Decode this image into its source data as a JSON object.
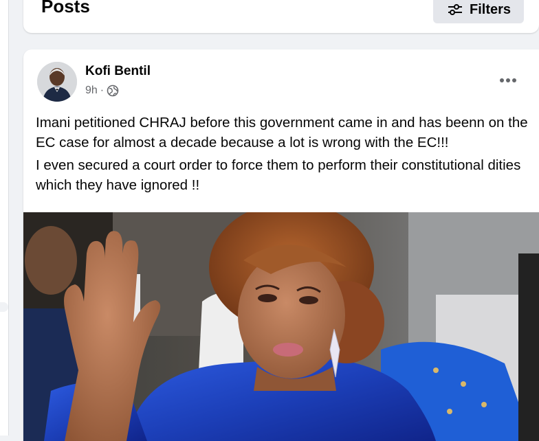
{
  "posts_header": {
    "title": "Posts",
    "filters_label": "Filters"
  },
  "post": {
    "author": "Kofi Bentil",
    "time": "9h",
    "separator": "·",
    "paragraphs": [
      "Imani petitioned CHRAJ before this government came in and has beenn on the EC case for almost a decade because a lot is wrong with the EC!!!",
      "I even secured a court order to force them to perform their constitutional dities which they have ignored !!"
    ]
  },
  "icons": {
    "filters": "sliders-icon",
    "audience": "globe-icon",
    "more": "more-horizontal-icon"
  },
  "colors": {
    "page_bg": "#f0f2f5",
    "card_bg": "#ffffff",
    "secondary_text": "#65676b",
    "button_bg": "#e4e6eb",
    "dress_blue": "#1f47c9"
  }
}
